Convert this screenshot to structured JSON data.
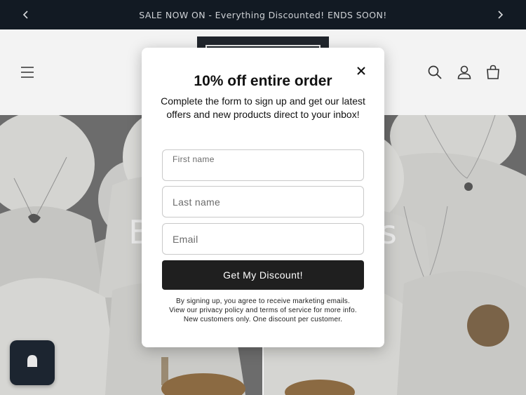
{
  "announcement": {
    "text": "SALE NOW ON - Everything Discounted! ENDS SOON!",
    "prev_icon": "chevron-left-icon",
    "next_icon": "chevron-right-icon"
  },
  "header": {
    "menu_icon": "menu-icon",
    "search_icon": "search-icon",
    "account_icon": "account-icon",
    "cart_icon": "cart-icon"
  },
  "hero": {
    "title": "Bro              ons"
  },
  "popup": {
    "title": "10% off entire order",
    "subtitle": "Complete the form to sign up and get our latest offers and new products direct to your inbox!",
    "close_icon": "close-icon",
    "first_name_placeholder": "First name",
    "last_name_placeholder": "Last name",
    "email_placeholder": "Email",
    "submit_label": "Get My Discount!",
    "legal_text": "By signing up, you agree to receive marketing emails. View our privacy policy and terms of service for more info. New customers only. One discount per customer."
  },
  "chat": {
    "icon": "chat-icon"
  },
  "colors": {
    "announcement_bg": "#121a23",
    "header_bg": "#f3f3f3",
    "button_bg": "#1f1f1f",
    "chat_bg": "#1c2530"
  }
}
